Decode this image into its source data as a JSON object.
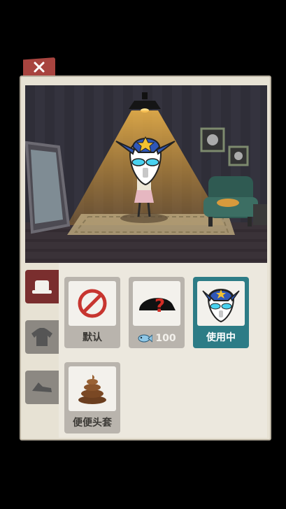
{
  "close_tab": {
    "icon": "close-x-icon"
  },
  "tabs": [
    {
      "name": "hat",
      "icon": "hat-icon",
      "active": true
    },
    {
      "name": "shirt",
      "icon": "shirt-icon",
      "active": false
    },
    {
      "name": "shoes",
      "icon": "shoes-icon",
      "active": false
    }
  ],
  "items": [
    {
      "label": "默认",
      "icon": "none-icon"
    },
    {
      "price": "100",
      "icon": "mystery-hat-icon",
      "currency_icon": "fish-icon"
    },
    {
      "label": "使用中",
      "icon": "ultraman-mask-icon",
      "selected": true
    },
    {
      "label": "便便头套",
      "icon": "poop-hat-icon"
    }
  ],
  "colors": {
    "accent": "#2d7c86",
    "tab_active": "#7a2e2e",
    "close_tab": "#a8443f"
  }
}
